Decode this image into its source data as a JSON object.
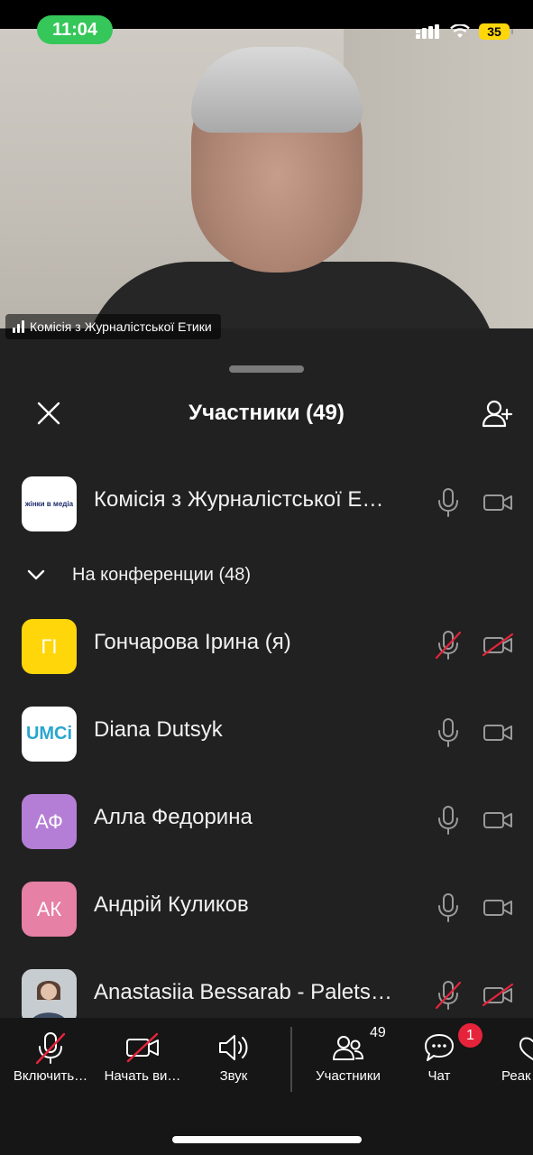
{
  "status_bar": {
    "time": "11:04",
    "battery": "35"
  },
  "video": {
    "speaker_name": "Комісія з Журналістської Етики"
  },
  "sheet": {
    "title": "Участники (49)",
    "host": {
      "name": "Комісія з Журналістської Е…",
      "avatar_text": "жінки в медіа"
    },
    "section_label": "На конференции (48)",
    "participants": [
      {
        "name": "Гончарова Ірина (я)",
        "initials": "ГІ",
        "color": "#ffd60a",
        "muted": true,
        "video_off": true
      },
      {
        "name": "Diana Dutsyk",
        "initials": "UMCi",
        "color": "#ffffff",
        "muted": false,
        "video_off": false
      },
      {
        "name": "Алла Федорина",
        "initials": "АФ",
        "color": "#b57ed6",
        "muted": false,
        "video_off": false
      },
      {
        "name": "Андрій Куликов",
        "initials": "АК",
        "color": "#e680a4",
        "muted": false,
        "video_off": false
      },
      {
        "name": "Anastasiia Bessarab - Palets…",
        "initials": "",
        "color": "#8a9aa8",
        "muted": true,
        "video_off": true
      }
    ]
  },
  "toolbar": {
    "audio_label": "Включить…",
    "video_label": "Начать ви…",
    "sound_label": "Звук",
    "participants_label": "Участники",
    "participants_count": "49",
    "chat_label": "Чат",
    "chat_badge": "1",
    "reactions_label": "Реак"
  },
  "colors": {
    "background": "#212121",
    "toolbar": "#161616",
    "muted_red": "#e5243b",
    "time_pill": "#35c759"
  }
}
